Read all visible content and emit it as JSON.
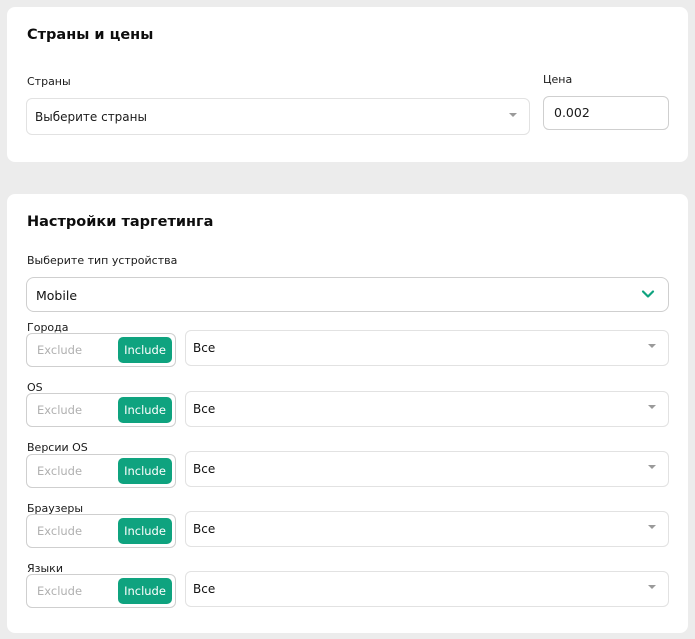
{
  "countries_card": {
    "title": "Страны и цены",
    "countries_label": "Страны",
    "countries_placeholder": "Выберите страны",
    "price_label": "Цена",
    "price_value": "0.002"
  },
  "targeting_card": {
    "title": "Настройки таргетинга",
    "device_label": "Выберите тип устройства",
    "device_value": "Mobile",
    "rows": [
      {
        "label": "Города",
        "exclude": "Exclude",
        "include": "Include",
        "value": "Все"
      },
      {
        "label": "OS",
        "exclude": "Exclude",
        "include": "Include",
        "value": "Все"
      },
      {
        "label": "Версии OS",
        "exclude": "Exclude",
        "include": "Include",
        "value": "Все"
      },
      {
        "label": "Браузеры",
        "exclude": "Exclude",
        "include": "Include",
        "value": "Все"
      },
      {
        "label": "Языки",
        "exclude": "Exclude",
        "include": "Include",
        "value": "Все"
      }
    ]
  },
  "colors": {
    "accent": "#0fa37f",
    "background": "#ececec",
    "card": "#ffffff"
  }
}
